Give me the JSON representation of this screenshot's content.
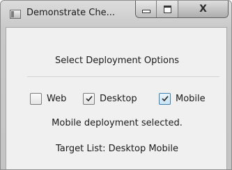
{
  "window": {
    "title": "Demonstrate Che...",
    "close_glyph": "X"
  },
  "content": {
    "heading": "Select Deployment Options",
    "options": [
      {
        "label": "Web",
        "checked": false
      },
      {
        "label": "Desktop",
        "checked": true
      },
      {
        "label": "Mobile",
        "checked": true
      }
    ],
    "status": "Mobile deployment selected.",
    "target_list": "Target List: Desktop Mobile"
  },
  "icons": {
    "app": "window-app-icon",
    "minimize": "minimize-icon",
    "maximize": "maximize-icon",
    "close": "close-icon",
    "check": "checkmark-icon"
  }
}
